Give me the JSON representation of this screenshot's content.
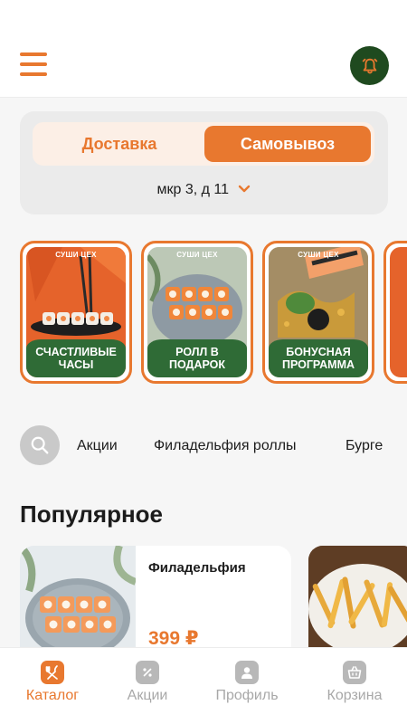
{
  "header": {
    "menu_icon": "hamburger-menu-icon",
    "notification_icon": "bell-icon",
    "accent_color": "#e8782f",
    "bell_bg_color": "#1f4a1f"
  },
  "delivery": {
    "tabs": [
      {
        "label": "Доставка",
        "active": false
      },
      {
        "label": "Самовывоз",
        "active": true
      }
    ],
    "address": "мкр 3, д 11"
  },
  "stories": [
    {
      "brand": "СУШИ ЦЕХ",
      "caption": "Счастливые часы"
    },
    {
      "brand": "СУШИ ЦЕХ",
      "caption": "Ролл в подарок"
    },
    {
      "brand": "СУШИ ЦЕХ",
      "caption": "Бонусная программа"
    }
  ],
  "categories": {
    "search_icon": "search-icon",
    "items": [
      "Акции",
      "Филадельфия роллы",
      "Бурге"
    ]
  },
  "popular": {
    "title": "Популярное",
    "products": [
      {
        "name": "Филадельфия",
        "price": "399 ₽"
      }
    ]
  },
  "tabbar": {
    "items": [
      {
        "label": "Каталог",
        "icon": "catalog-icon",
        "active": true
      },
      {
        "label": "Акции",
        "icon": "discount-icon",
        "active": false
      },
      {
        "label": "Профиль",
        "icon": "profile-icon",
        "active": false
      },
      {
        "label": "Корзина",
        "icon": "cart-icon",
        "active": false
      }
    ]
  }
}
